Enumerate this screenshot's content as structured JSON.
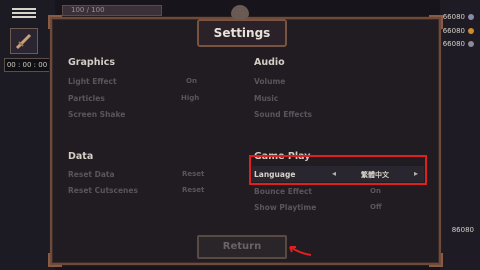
{
  "hud": {
    "hp": "100 / 100",
    "timer": "00 : 00 : 00",
    "resources": [
      "66080",
      "66080",
      "66080",
      "86080"
    ]
  },
  "settings": {
    "title": "Settings",
    "graphics": {
      "heading": "Graphics",
      "items": [
        {
          "label": "Light Effect",
          "value": "On"
        },
        {
          "label": "Particles",
          "value": "High"
        },
        {
          "label": "Screen Shake",
          "value": ""
        }
      ]
    },
    "audio": {
      "heading": "Audio",
      "items": [
        {
          "label": "Volume"
        },
        {
          "label": "Music"
        },
        {
          "label": "Sound Effects"
        }
      ]
    },
    "data": {
      "heading": "Data",
      "items": [
        {
          "label": "Reset Data",
          "value": "Reset"
        },
        {
          "label": "Reset Cutscenes",
          "value": "Reset"
        }
      ]
    },
    "gameplay": {
      "heading": "Game Play",
      "language_label": "Language",
      "language_value": "繁體中文",
      "items": [
        {
          "label": "Bounce Effect",
          "value": "On"
        },
        {
          "label": "Show Playtime",
          "value": "Off"
        }
      ]
    },
    "return_label": "Return"
  },
  "colors": {
    "highlight": "#e02020",
    "frame": "#6e4a3a"
  }
}
